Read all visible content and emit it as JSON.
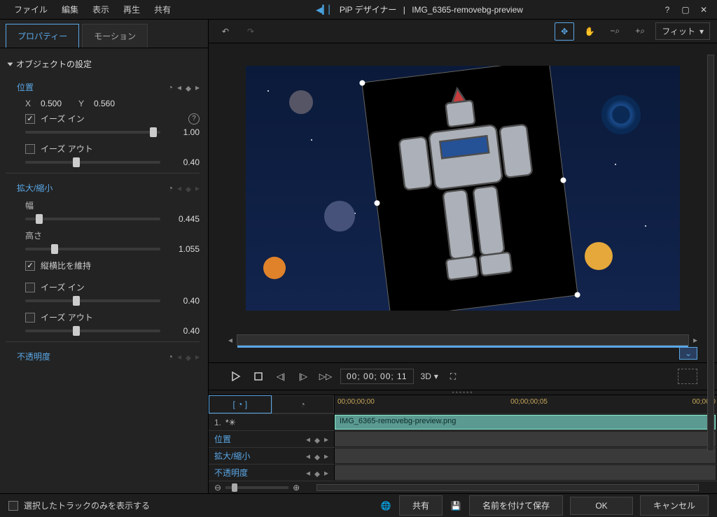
{
  "menus": {
    "file": "ファイル",
    "edit": "編集",
    "view": "表示",
    "play": "再生",
    "share": "共有"
  },
  "app_title": "PiP デザイナー",
  "document_name": "IMG_6365-removebg-preview",
  "tabs": {
    "properties": "プロパティー",
    "motion": "モーション"
  },
  "sections": {
    "object_settings": "オブジェクトの設定",
    "position": {
      "label": "位置",
      "x_label": "X",
      "x_value": "0.500",
      "y_label": "Y",
      "y_value": "0.560"
    },
    "ease_in": {
      "label": "イーズ イン",
      "value": "1.00",
      "checked": true
    },
    "ease_out": {
      "label": "イーズ アウト",
      "value": "0.40",
      "checked": false
    },
    "scale": {
      "label": "拡大/縮小",
      "width_label": "幅",
      "width_value": "0.445",
      "height_label": "高さ",
      "height_value": "1.055",
      "keep_ratio": "縦横比を維持",
      "keep_ratio_checked": true
    },
    "scale_ease_in": {
      "label": "イーズ イン",
      "value": "0.40",
      "checked": false
    },
    "scale_ease_out": {
      "label": "イーズ アウト",
      "value": "0.40",
      "checked": false
    },
    "opacity": {
      "label": "不透明度"
    }
  },
  "toolbar": {
    "fit": "フィット"
  },
  "playback": {
    "timecode": "00; 00; 00; 11",
    "threeD": "3D"
  },
  "timeline": {
    "ruler": {
      "t0": "00;00;00;00",
      "t1": "00;00;00;05",
      "t2": "00;00;0"
    },
    "clip_index": "1.",
    "clip_name": "IMG_6365-removebg-preview.png",
    "tracks": {
      "position": "位置",
      "scale": "拡大/縮小",
      "opacity": "不透明度"
    }
  },
  "footer": {
    "show_selected_only": "選択したトラックのみを表示する",
    "share": "共有",
    "save_as": "名前を付けて保存",
    "ok": "OK",
    "cancel": "キャンセル"
  }
}
